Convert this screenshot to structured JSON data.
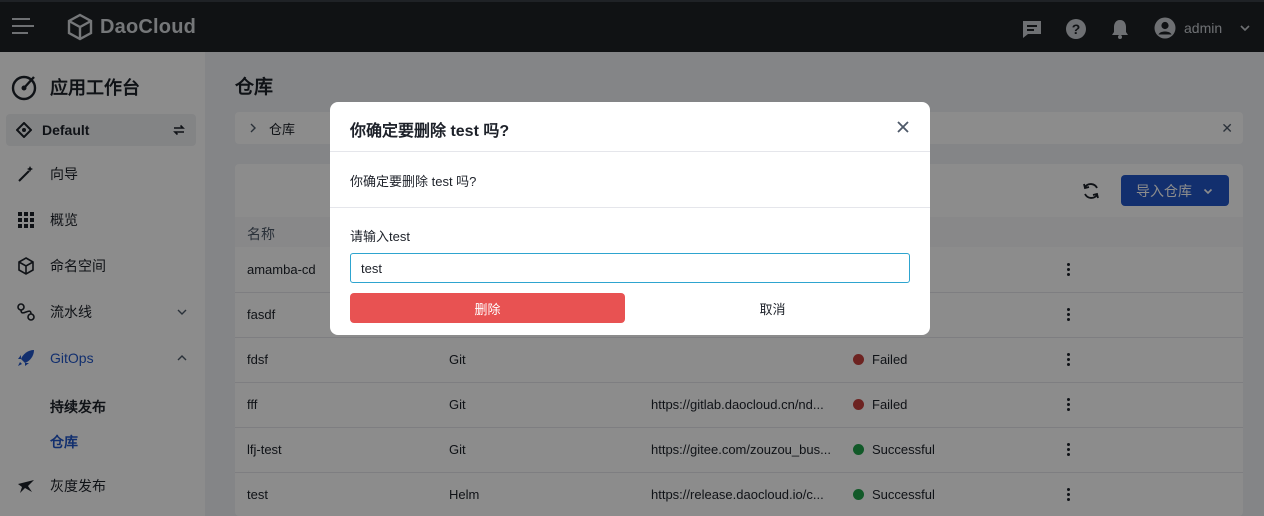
{
  "topbar": {
    "brand": "DaoCloud",
    "user_name": "admin"
  },
  "sidebar": {
    "workspace_title": "应用工作台",
    "workspace_select": "Default",
    "items": [
      {
        "label": "向导",
        "icon": "wand-icon"
      },
      {
        "label": "概览",
        "icon": "grid-icon"
      },
      {
        "label": "命名空间",
        "icon": "cube-icon"
      },
      {
        "label": "流水线",
        "icon": "pipeline-icon"
      },
      {
        "label": "GitOps",
        "icon": "rocket-icon"
      },
      {
        "label": "灰度发布",
        "icon": "bird-icon"
      }
    ],
    "sub_items": [
      "持续发布",
      "仓库"
    ]
  },
  "colors": {
    "accent": "#2156c9",
    "danger": "#e85252",
    "failed": "#c7403d",
    "successful": "#1fa34a",
    "topbar": "#1e2226"
  },
  "main": {
    "page_title": "仓库",
    "breadcrumb": "仓库",
    "import_button": "导入仓库",
    "table": {
      "headers": [
        "名称"
      ],
      "rows": [
        {
          "name": "amamba-cd",
          "type": "",
          "url": "",
          "status": ""
        },
        {
          "name": "fasdf",
          "type": "",
          "url": "",
          "status": ""
        },
        {
          "name": "fdsf",
          "type": "Git",
          "url": "",
          "status": "Failed"
        },
        {
          "name": "fff",
          "type": "Git",
          "url": "https://gitlab.daocloud.cn/nd...",
          "status": "Failed"
        },
        {
          "name": "lfj-test",
          "type": "Git",
          "url": "https://gitee.com/zouzou_bus...",
          "status": "Successful"
        },
        {
          "name": "test",
          "type": "Helm",
          "url": "https://release.daocloud.io/c...",
          "status": "Successful"
        }
      ]
    }
  },
  "dialog": {
    "title": "你确定要删除 test 吗?",
    "message": "你确定要删除 test 吗?",
    "input_label": "请输入test",
    "input_value": "test",
    "delete_button": "删除",
    "cancel_button": "取消"
  }
}
